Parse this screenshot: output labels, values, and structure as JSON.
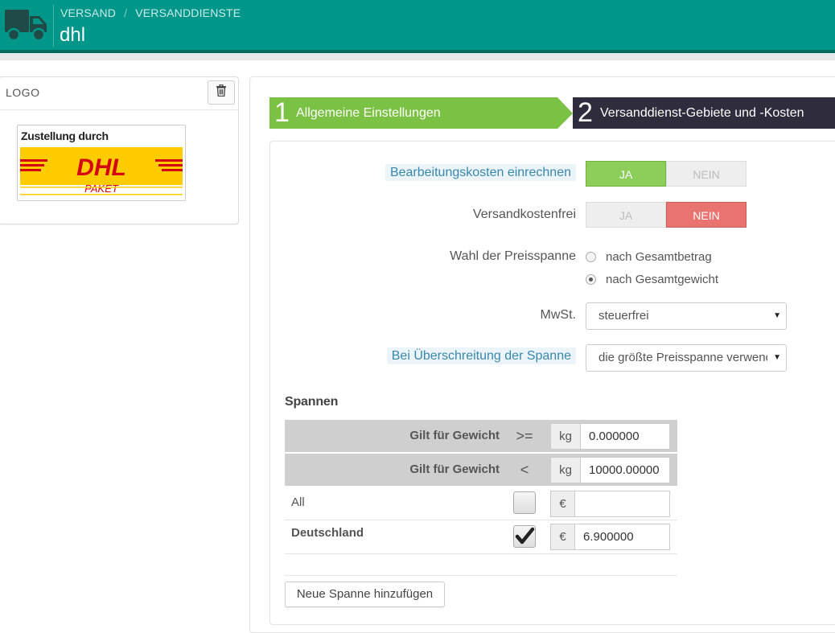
{
  "header": {
    "icon": "truck-icon",
    "breadcrumb": [
      "VERSAND",
      "VERSANDDIENSTE"
    ],
    "breadcrumb_separator": "/",
    "title": "dhl",
    "colors": {
      "bar": "#00978a",
      "bar_dark": "#006a5f"
    }
  },
  "logo_panel": {
    "label": "LOGO",
    "delete_icon": "trash-icon",
    "image": {
      "caption": "Zustellung durch",
      "brand": "DHL",
      "sub": "PAKET"
    }
  },
  "wizard": {
    "steps": [
      {
        "number": "1",
        "label": "Allgemeine Einstellungen",
        "state": "done",
        "color": "#7bc143"
      },
      {
        "number": "2",
        "label": "Versanddienst-Gebiete und -Kosten",
        "state": "active",
        "color": "#2e2c3d"
      }
    ]
  },
  "form": {
    "handling_costs": {
      "label": "Bearbeitungskosten einrechnen",
      "yes": "JA",
      "no": "NEIN",
      "value": "JA"
    },
    "free_shipping": {
      "label": "Versandkostenfrei",
      "yes": "JA",
      "no": "NEIN",
      "value": "NEIN"
    },
    "price_range": {
      "label": "Wahl der Preisspanne",
      "options": [
        "nach Gesamtbetrag",
        "nach Gesamtgewicht"
      ],
      "selected": "nach Gesamtgewicht"
    },
    "tax": {
      "label": "MwSt.",
      "value": "steuerfrei"
    },
    "out_of_range": {
      "label": "Bei Überschreitung der Spanne",
      "value": "die größte Preisspanne verwenden"
    }
  },
  "ranges": {
    "title": "Spannen",
    "rows": [
      {
        "label": "Gilt für Gewicht",
        "operator": ">=",
        "unit": "kg",
        "value": "0.000000"
      },
      {
        "label": "Gilt für Gewicht",
        "operator": "<",
        "unit": "kg",
        "value": "10000.00000"
      }
    ],
    "zones": [
      {
        "name": "All",
        "checked": false,
        "currency": "€",
        "price": ""
      },
      {
        "name": "Deutschland",
        "checked": true,
        "currency": "€",
        "price": "6.900000"
      }
    ],
    "add_button": "Neue Spanne hinzufügen"
  }
}
